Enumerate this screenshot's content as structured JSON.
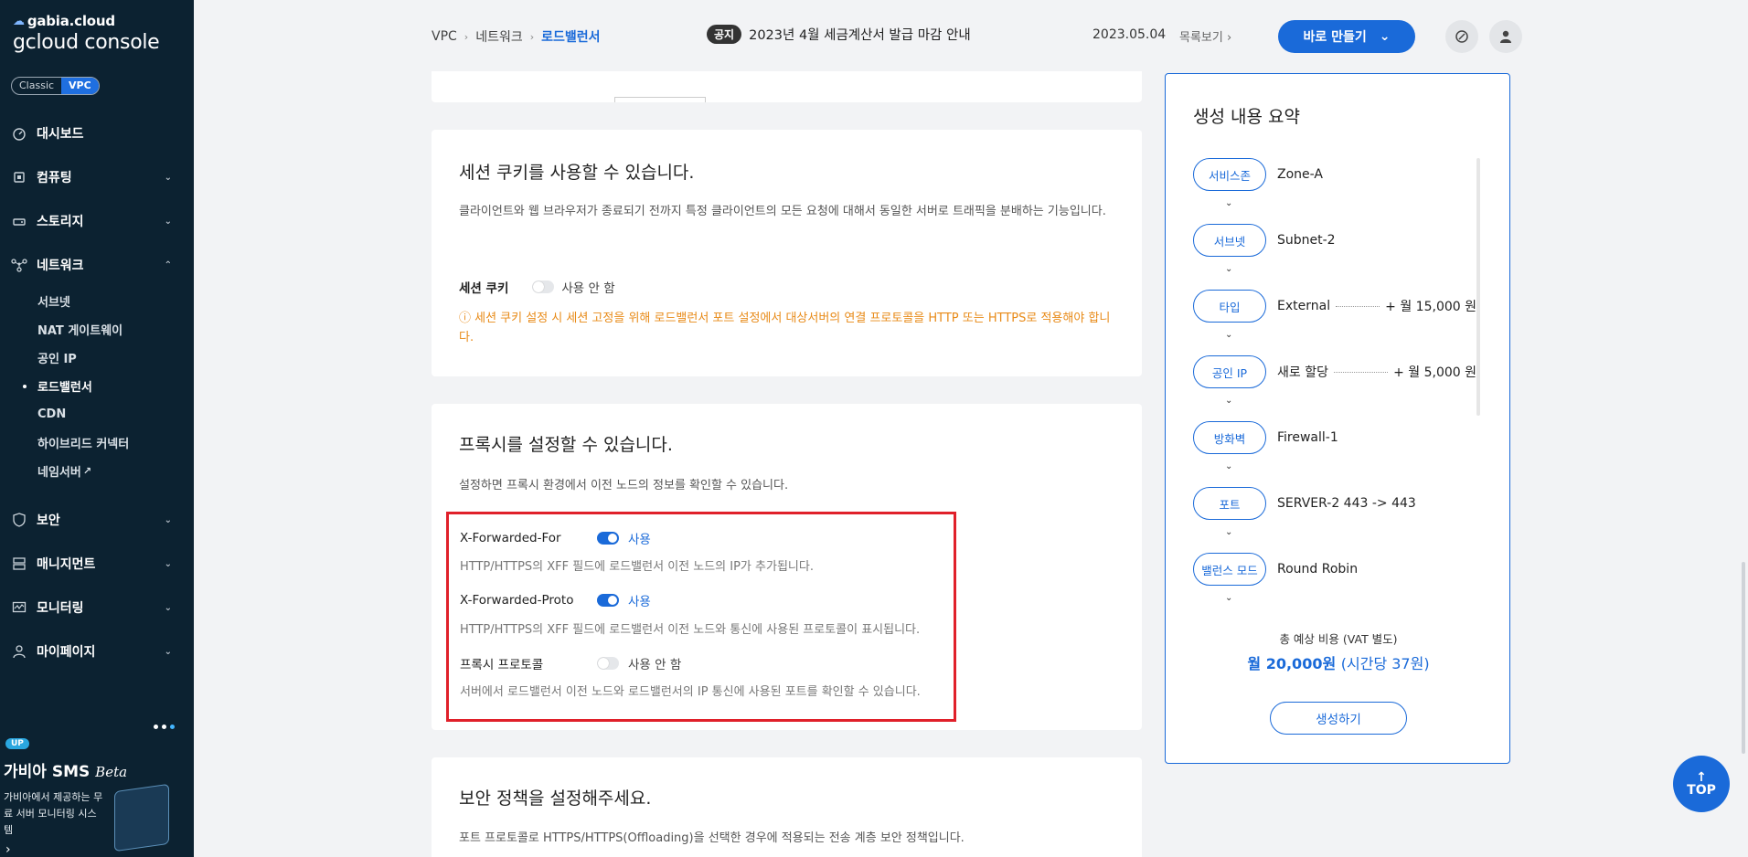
{
  "sidebar": {
    "brand_top": "gabia.cloud",
    "brand_bottom": "gcloud console",
    "mode_classic": "Classic",
    "mode_vpc": "VPC",
    "items": [
      {
        "label": "대시보드",
        "icon": "dashboard-icon"
      },
      {
        "label": "컴퓨팅",
        "icon": "chip-icon"
      },
      {
        "label": "스토리지",
        "icon": "storage-icon"
      },
      {
        "label": "네트워크",
        "icon": "network-icon"
      },
      {
        "label": "보안",
        "icon": "shield-icon"
      },
      {
        "label": "매니지먼트",
        "icon": "management-icon"
      },
      {
        "label": "모니터링",
        "icon": "monitor-icon"
      },
      {
        "label": "마이페이지",
        "icon": "user-icon"
      }
    ],
    "network_sub": [
      "서브넷",
      "NAT 게이트웨이",
      "공인 IP",
      "로드밸런서",
      "CDN",
      "하이브리드 커넥터",
      "네임서버"
    ],
    "promo": {
      "badge": "UP",
      "title": "가비아 SMS",
      "title_suffix": "Beta",
      "desc": "가비아에서 제공하는 무료 서버 모니터링 시스템"
    }
  },
  "topbar": {
    "breadcrumb": [
      "VPC",
      "네트워크",
      "로드밸런서"
    ],
    "notice_tag": "공지",
    "notice_text": "2023년 4월 세금계산서 발급 마감 안내",
    "date": "2023.05.04",
    "more": "목록보기",
    "make_button": "바로 만들기"
  },
  "session": {
    "title": "세션 쿠키를 사용할 수 있습니다.",
    "desc": "클라이언트와 웹 브라우저가 종료되기 전까지 특정 클라이언트의 모든 요청에 대해서 동일한 서버로 트래픽을 분배하는 기능입니다.",
    "label": "세션 쿠키",
    "state": "사용 안 함",
    "warning": "ⓘ 세션 쿠키 설정 시 세션 고정을 위해 로드밸런서 포트 설정에서 대상서버의 연결 프로토콜을 HTTP 또는 HTTPS로 적용해야 합니다."
  },
  "proxy": {
    "title": "프록시를 설정할 수 있습니다.",
    "desc": "설정하면 프록시 환경에서 이전 노드의 정보를 확인할 수 있습니다.",
    "rows": [
      {
        "label": "X-Forwarded-For",
        "state": "사용",
        "on": true,
        "desc": "HTTP/HTTPS의 XFF 필드에 로드밸런서 이전 노드의 IP가 추가됩니다."
      },
      {
        "label": "X-Forwarded-Proto",
        "state": "사용",
        "on": true,
        "desc": "HTTP/HTTPS의 XFF 필드에 로드밸런서 이전 노드와 통신에 사용된 프로토콜이 표시됩니다."
      },
      {
        "label": "프록시 프로토콜",
        "state": "사용 안 함",
        "on": false,
        "desc": "서버에서 로드밸런서 이전 노드와 로드밸런서의 IP 통신에 사용된 포트를 확인할 수 있습니다."
      }
    ]
  },
  "security": {
    "title": "보안 정책을 설정해주세요.",
    "desc": "포트 프로토콜로 HTTPS/HTTPS(Offloading)을 선택한 경우에 적용되는 전송 계층 보안 정책입니다."
  },
  "summary": {
    "title": "생성 내용 요약",
    "items": [
      {
        "pill": "서비스존",
        "value": "Zone-A",
        "price": ""
      },
      {
        "pill": "서브넷",
        "value": "Subnet-2",
        "price": ""
      },
      {
        "pill": "타입",
        "value": "External",
        "price": "+ 월 15,000 원"
      },
      {
        "pill": "공인 IP",
        "value": "새로 할당",
        "price": "+ 월 5,000 원"
      },
      {
        "pill": "방화벽",
        "value": "Firewall-1",
        "price": ""
      },
      {
        "pill": "포트",
        "value": "SERVER-2 443 -> 443",
        "price": ""
      },
      {
        "pill": "밸런스 모드",
        "value": "Round Robin",
        "price": ""
      }
    ],
    "cost_label": "총 예상 비용 (VAT 별도)",
    "cost_value": "월 20,000원",
    "cost_hourly": "(시간당 37원)",
    "create_button": "생성하기"
  },
  "top_button": "TOP",
  "colors": {
    "accent": "#1a6ad9",
    "sidebar": "#0c2231",
    "warning": "#e88a17",
    "highlight": "#e0202a"
  }
}
